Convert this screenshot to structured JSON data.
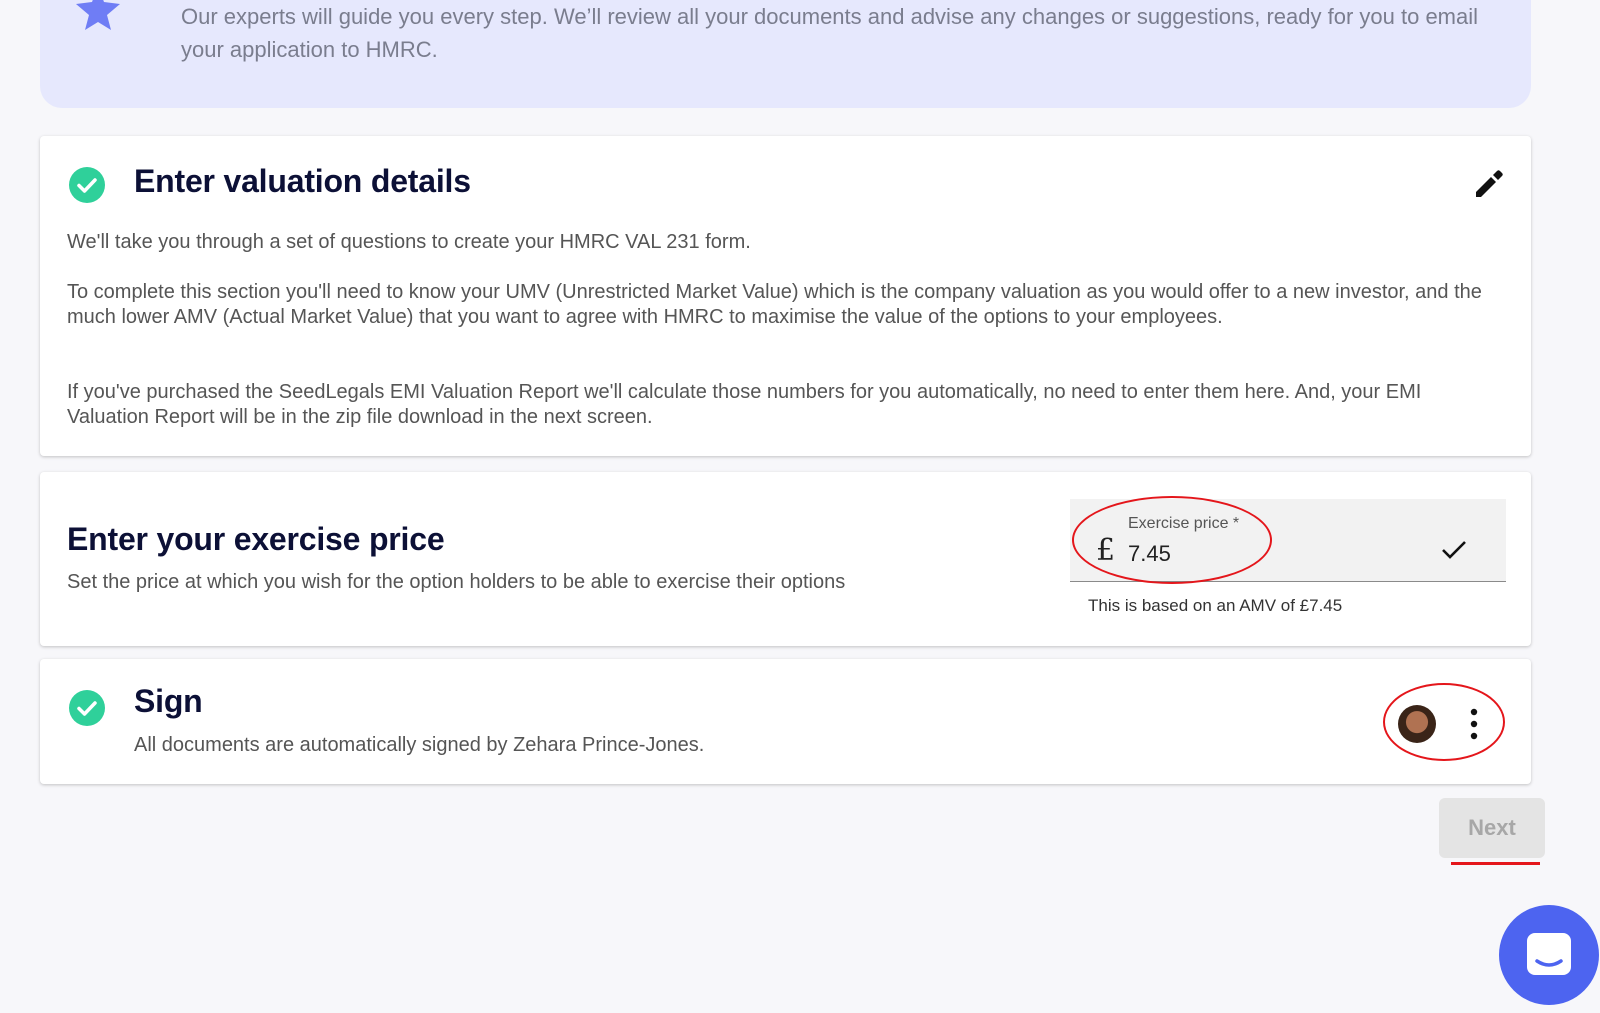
{
  "banner": {
    "text": "Our experts will guide you every step. We’ll review all your documents and advise any changes or suggestions, ready for you to email your application to HMRC.",
    "icon": "star-icon"
  },
  "valuation": {
    "title": "Enter valuation details",
    "status": "completed",
    "p1": "We'll take you through a set of questions to create your HMRC VAL 231 form.",
    "p2": "To complete this section you'll need to know your UMV (Unrestricted Market Value) which is the company valuation as you would offer to a new investor, and the much lower AMV (Actual Market Value) that you want to agree with HMRC to maximise the value of the options to your employees.",
    "p3": "If you've purchased the SeedLegals EMI Valuation Report we'll calculate those numbers for you automatically, no need to enter them here. And, your EMI Valuation Report will be in the zip file download in the next screen."
  },
  "exercise": {
    "title": "Enter your exercise price",
    "subtitle": "Set the price at which you wish for the option holders to be able to exercise their options",
    "field_label": "Exercise price *",
    "currency": "£",
    "value": "7.45",
    "helper": "This is based on an AMV of £7.45"
  },
  "sign": {
    "title": "Sign",
    "status": "completed",
    "subtitle": "All documents are automatically signed by Zehara Prince-Jones."
  },
  "next_label": "Next",
  "colors": {
    "accent": "#4d64f0",
    "success": "#2fd09a",
    "heading": "#0c1036",
    "annotation": "#e4161b",
    "banner_bg": "#e6e8fd"
  }
}
